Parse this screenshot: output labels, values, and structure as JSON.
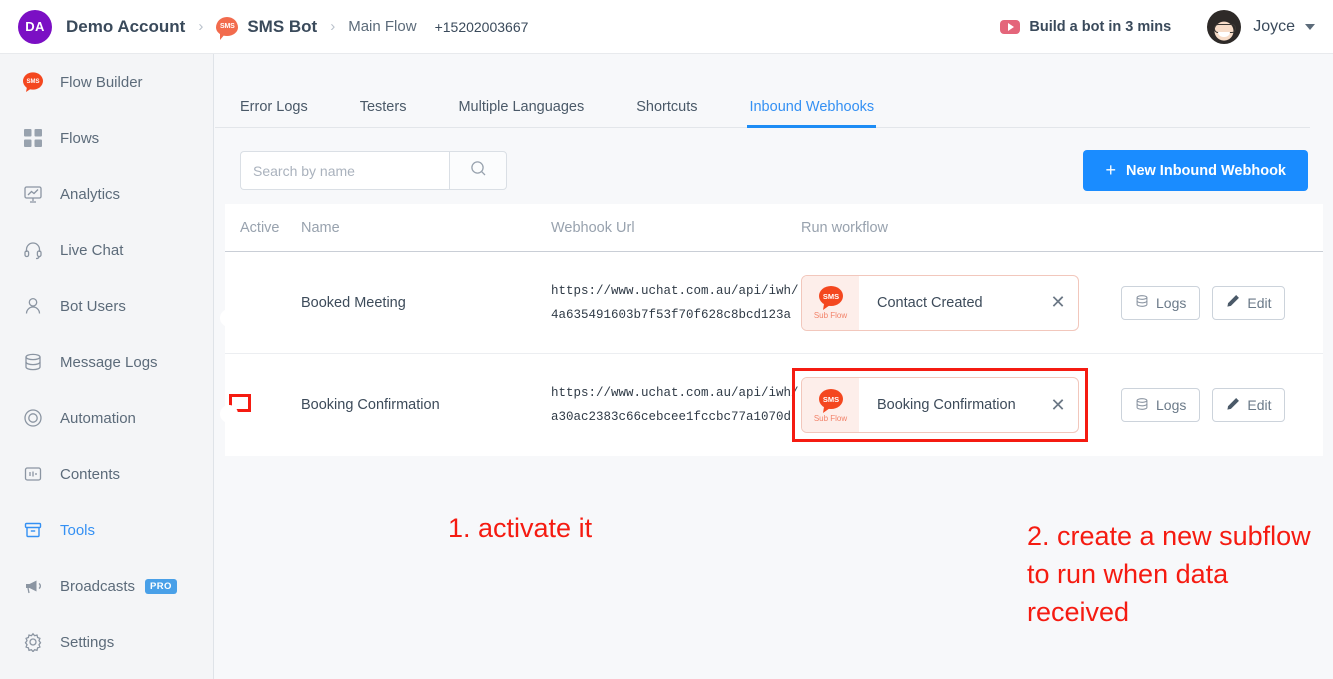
{
  "header": {
    "account_initials": "DA",
    "account_name": "Demo Account",
    "separator": "›",
    "bot_icon_label": "SMS",
    "bot_name": "SMS Bot",
    "flow_name": "Main Flow",
    "phone": "+15202003667",
    "build_link": "Build a bot in 3 mins",
    "user_name": "Joyce"
  },
  "sidebar": {
    "items": [
      {
        "label": "Flow Builder",
        "icon": "sms-bubble-icon",
        "active": false
      },
      {
        "label": "Flows",
        "icon": "grid-icon",
        "active": false
      },
      {
        "label": "Analytics",
        "icon": "chart-board-icon",
        "active": false
      },
      {
        "label": "Live Chat",
        "icon": "headset-icon",
        "active": false
      },
      {
        "label": "Bot Users",
        "icon": "user-icon",
        "active": false
      },
      {
        "label": "Message Logs",
        "icon": "database-icon",
        "active": false
      },
      {
        "label": "Automation",
        "icon": "automation-circle-icon",
        "active": false
      },
      {
        "label": "Contents",
        "icon": "contents-icon",
        "active": false
      },
      {
        "label": "Tools",
        "icon": "tools-archive-icon",
        "active": true
      },
      {
        "label": "Broadcasts",
        "icon": "megaphone-icon",
        "active": false,
        "badge": "PRO"
      },
      {
        "label": "Settings",
        "icon": "gear-icon",
        "active": false
      }
    ]
  },
  "tabs": [
    {
      "label": "Error Logs",
      "active": false
    },
    {
      "label": "Testers",
      "active": false
    },
    {
      "label": "Multiple Languages",
      "active": false
    },
    {
      "label": "Shortcuts",
      "active": false
    },
    {
      "label": "Inbound Webhooks",
      "active": true
    }
  ],
  "toolbar": {
    "search_placeholder": "Search by name",
    "search_value": "",
    "search_icon": "search-icon",
    "new_button_plus": "+",
    "new_button_label": "New Inbound Webhook"
  },
  "table": {
    "columns": [
      "Active",
      "Name",
      "Webhook Url",
      "Run workflow"
    ],
    "rows": [
      {
        "active": true,
        "name": "Booked Meeting",
        "url_line1": "https://www.uchat.com.au/api/iwh/",
        "url_line2": "4a635491603b7f53f70f628c8bcd123a",
        "flow_badge": "SMS",
        "flow_type": "Sub Flow",
        "flow_name": "Contact Created",
        "logs_label": "Logs",
        "edit_label": "Edit",
        "highlight_toggle": false,
        "highlight_flow": false
      },
      {
        "active": true,
        "name": "Booking Confirmation",
        "url_line1": "https://www.uchat.com.au/api/iwh/",
        "url_line2": "a30ac2383c66cebcee1fccbc77a1070d",
        "flow_badge": "SMS",
        "flow_type": "Sub Flow",
        "flow_name": "Booking Confirmation",
        "logs_label": "Logs",
        "edit_label": "Edit",
        "highlight_toggle": true,
        "highlight_flow": true
      }
    ]
  },
  "annotations": {
    "one": "1. activate it",
    "two": "2. create a new subflow\nto run when data received",
    "color": "#f51b11"
  },
  "colors": {
    "accent_blue": "#1a8cff",
    "toggle_green": "#22c55e",
    "brand_orange": "#f26b4d",
    "annotation_red": "#f51b11"
  }
}
